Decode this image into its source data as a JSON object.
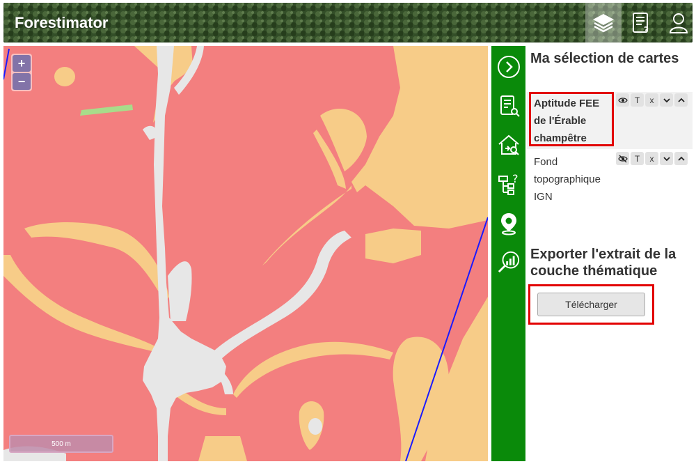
{
  "header": {
    "title": "Forestimator",
    "buttons": [
      {
        "icon": "layers-icon",
        "active": true
      },
      {
        "icon": "catalog-icon"
      },
      {
        "icon": "user-icon"
      }
    ]
  },
  "map": {
    "zoom_in": "+",
    "zoom_out": "−",
    "scale_label": "500 m",
    "colors": {
      "unsuitable": "#f37f7f",
      "tolerated": "#f7cc88",
      "excluded": "#e7e7e7",
      "optimal": "#a8dc8a",
      "boundary": "#1a1aff"
    }
  },
  "toolbar": {
    "icons": [
      "collapse-arrow-icon",
      "catalog-search-icon",
      "station-search-icon",
      "decision-tree-help-icon",
      "location-pin-icon",
      "analysis-chart-icon"
    ]
  },
  "panel": {
    "selection_title": "Ma sélection de cartes",
    "layers": [
      {
        "name": "Aptitude FEE de l'Érable champêtre",
        "visible": true,
        "ctrl_t": "T",
        "ctrl_x": "x"
      },
      {
        "name": "Fond topographique IGN",
        "visible": false,
        "ctrl_t": "T",
        "ctrl_x": "x"
      }
    ],
    "export_title": "Exporter l'extrait de la couche thématique",
    "download_label": "Télécharger"
  },
  "colors": {
    "toolbar_green": "#0a8a0a",
    "highlight_red": "#e20000"
  }
}
